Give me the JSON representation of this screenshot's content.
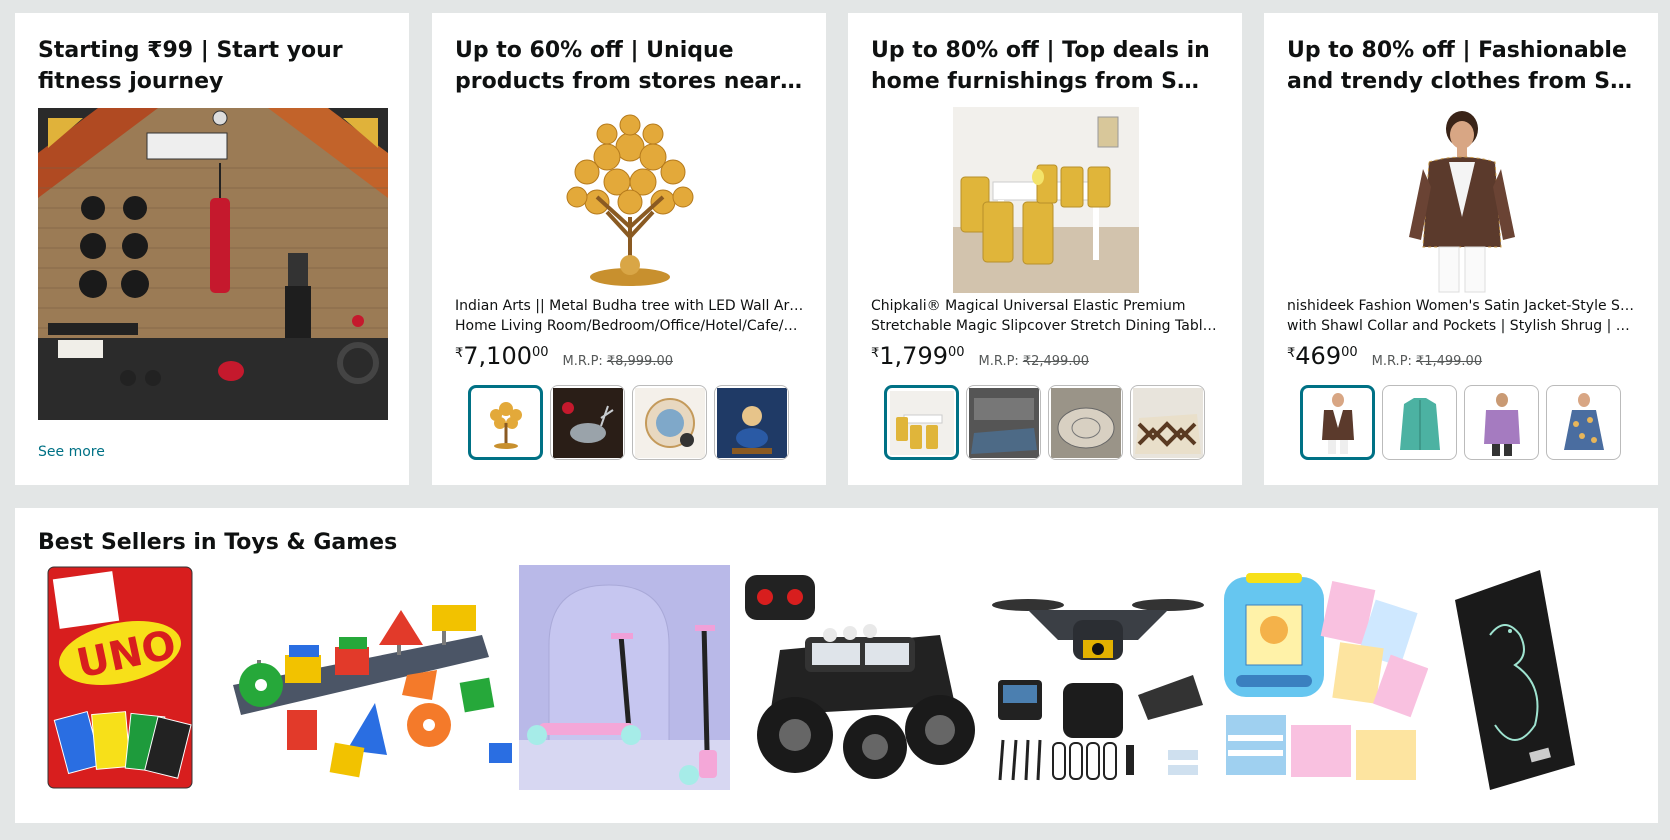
{
  "cards": [
    {
      "title_line1": "Starting ₹99 | Start your",
      "title_line2": "fitness journey",
      "see_more": "See more"
    },
    {
      "title_line1": "Up to 60% off | Unique",
      "title_line2": "products from stores nearby",
      "product_line1": "Indian Arts || Metal Budha tree with LED Wall Artfor",
      "product_line2": "Home Living Room/Bedroom/Office/Hotel/Cafe/F…",
      "currency": "₹",
      "price_whole": "7,100",
      "price_fraction": "00",
      "mrp_label": "M.R.P:",
      "mrp_value": "₹8,999.00"
    },
    {
      "title_line1": "Up to 80% off | Top deals in",
      "title_line2": "home furnishings from Small…",
      "product_line1": "Chipkali® Magical Universal Elastic Premium",
      "product_line2": "Stretchable Magic Slipcover Stretch Dining Table…",
      "currency": "₹",
      "price_whole": "1,799",
      "price_fraction": "00",
      "mrp_label": "M.R.P:",
      "mrp_value": "₹2,499.00"
    },
    {
      "title_line1": "Up to 80% off | Fashionable",
      "title_line2": "and trendy clothes from Sma…",
      "product_line1": "nishideek Fashion Women's Satin Jacket-Style Shrug",
      "product_line2": "with Shawl Collar and Pockets | Stylish Shrug | Wo…",
      "currency": "₹",
      "price_whole": "469",
      "price_fraction": "00",
      "mrp_label": "M.R.P:",
      "mrp_value": "₹1,499.00"
    }
  ],
  "best_sellers": {
    "title": "Best Sellers in Toys & Games",
    "items": [
      "uno-cards",
      "shape-sorter",
      "kick-scooter",
      "rc-monster-truck",
      "drone-kit",
      "talking-flash-cards",
      "lcd-writing-tablet"
    ]
  },
  "colors": {
    "background": "#e3e6e6",
    "link": "#007185",
    "selected_thumb_border": "#007185",
    "text": "#0f1111"
  }
}
